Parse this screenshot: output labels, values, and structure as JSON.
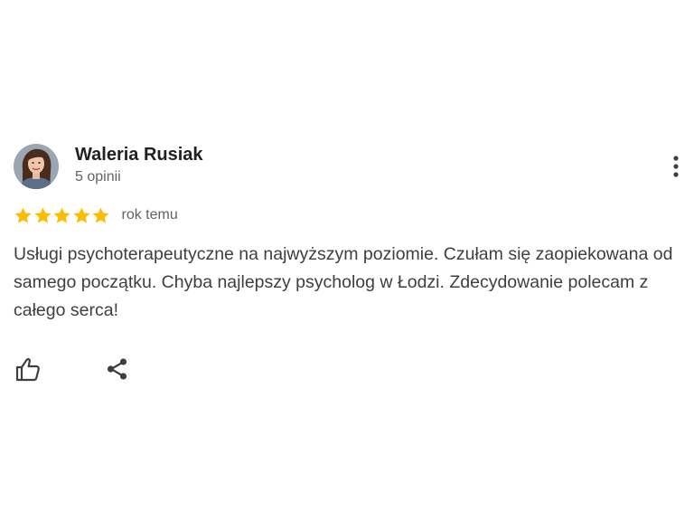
{
  "review": {
    "author_name": "Waleria Rusiak",
    "review_count": "5 opinii",
    "rating": 5,
    "rating_max": 5,
    "date": "rok temu",
    "text": "Usługi psychoterapeutyczne na najwyższym poziomie. Czułam się zaopiekowana od samego początku. Chyba najlepszy psycholog w Łodzi. Zdecydowanie polecam z całego serca!"
  },
  "icons": {
    "more": "more-vertical-icon",
    "like": "thumb-up-icon",
    "share": "share-icon",
    "star": "star-icon"
  },
  "colors": {
    "star": "#fbbc04",
    "name": "#202124",
    "secondary": "#5f6368",
    "body_text": "#3c4043",
    "icon": "#3c4043"
  }
}
